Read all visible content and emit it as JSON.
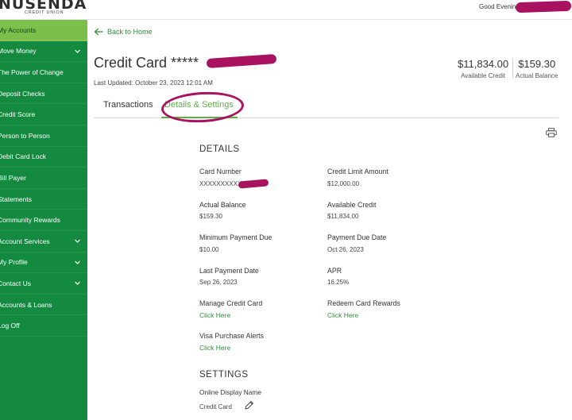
{
  "header": {
    "brand": "NUSENDA",
    "brand_sub": "CREDIT UNION",
    "greeting": "Good Evening"
  },
  "sidebar": {
    "items": [
      {
        "label": "My Accounts",
        "active": true,
        "chevron": false
      },
      {
        "label": "Move Money",
        "active": false,
        "chevron": true
      },
      {
        "label": "The Power of Change",
        "active": false,
        "chevron": false
      },
      {
        "label": "Deposit Checks",
        "active": false,
        "chevron": false
      },
      {
        "label": "Credit Score",
        "active": false,
        "chevron": false
      },
      {
        "label": "Person to Person",
        "active": false,
        "chevron": false
      },
      {
        "label": "Debit Card Lock",
        "active": false,
        "chevron": false
      },
      {
        "label": "Bill Payer",
        "active": false,
        "chevron": false
      },
      {
        "label": "Statements",
        "active": false,
        "chevron": false
      },
      {
        "label": "Community Rewards",
        "active": false,
        "chevron": false
      },
      {
        "label": "Account Services",
        "active": false,
        "chevron": true
      },
      {
        "label": "My Profile",
        "active": false,
        "chevron": true
      },
      {
        "label": "Contact Us",
        "active": false,
        "chevron": true
      },
      {
        "label": "Accounts & Loans",
        "active": false,
        "chevron": false
      },
      {
        "label": "Log Off",
        "active": false,
        "chevron": false
      }
    ]
  },
  "main": {
    "back_label": "Back to Home",
    "title": "Credit Card *****",
    "last_updated": "Last Updated: October 23, 2023 12:01 AM",
    "balances": [
      {
        "amount": "$11,834.00",
        "caption": "Available Credit"
      },
      {
        "amount": "$159.30",
        "caption": "Actual Balance"
      }
    ],
    "tabs": [
      {
        "label": "Transactions",
        "active": false
      },
      {
        "label": "Details & Settings",
        "active": true
      }
    ],
    "details_heading": "DETAILS",
    "details": {
      "card_number": {
        "label": "Card Number",
        "value": "XXXXXXXXXX"
      },
      "credit_limit": {
        "label": "Credit Limit Amount",
        "value": "$12,000.00"
      },
      "actual_balance": {
        "label": "Actual Balance",
        "value": "$159.30"
      },
      "available_credit": {
        "label": "Available Credit",
        "value": "$11,834.00"
      },
      "min_payment": {
        "label": "Minimum Payment Due",
        "value": "$10.00"
      },
      "payment_due_date": {
        "label": "Payment Due Date",
        "value": "Oct 26, 2023"
      },
      "last_payment_date": {
        "label": "Last Payment Date",
        "value": "Sep 26, 2023"
      },
      "apr": {
        "label": "APR",
        "value": "16.25%"
      },
      "manage_card": {
        "label": "Manage Credit Card",
        "link": "Click Here"
      },
      "redeem_rewards": {
        "label": "Redeem Card Rewards",
        "link": "Click Here"
      },
      "visa_alerts": {
        "label": "Visa Purchase Alerts",
        "link": "Click Here"
      }
    },
    "settings_heading": "SETTINGS",
    "settings": {
      "display_name_label": "Online Display Name",
      "display_name_value": "Credit Card"
    }
  },
  "colors": {
    "sidebar": "#138a3f",
    "sidebar_active": "#7cc04b",
    "link": "#2f8a3f",
    "redaction": "#a8125f"
  }
}
